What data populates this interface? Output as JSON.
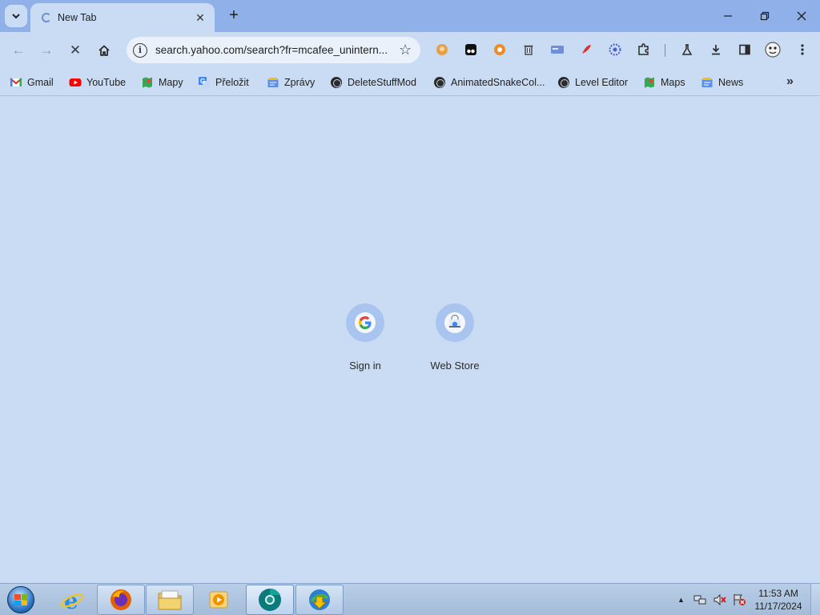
{
  "browser": {
    "tab": {
      "title": "New Tab"
    },
    "new_tab_symbol": "+",
    "window_controls": {
      "minimize": "—",
      "restore": "❐",
      "close": "✕"
    },
    "toolbar": {
      "back": "←",
      "forward": "→",
      "stop": "✕",
      "url": "search.yahoo.com/search?fr=mcafee_unintern..."
    },
    "bookmarks": [
      {
        "label": "Gmail",
        "icon": "gmail-icon"
      },
      {
        "label": "YouTube",
        "icon": "youtube-icon"
      },
      {
        "label": "Mapy",
        "icon": "maps-icon"
      },
      {
        "label": "Přeložit",
        "icon": "translate-icon"
      },
      {
        "label": "Zprávy",
        "icon": "news-icon"
      },
      {
        "label": "DeleteStuffMod",
        "icon": "globe-icon"
      },
      {
        "label": "AnimatedSnakeCol...",
        "icon": "globe-icon"
      },
      {
        "label": "Level Editor",
        "icon": "globe-icon"
      },
      {
        "label": "Maps",
        "icon": "maps-icon"
      },
      {
        "label": "News",
        "icon": "news-icon"
      }
    ],
    "bookmarks_overflow": "»"
  },
  "shortcuts": [
    {
      "label": "Sign in",
      "icon": "google-icon"
    },
    {
      "label": "Web Store",
      "icon": "web-store-icon"
    }
  ],
  "taskbar": {
    "apps": [
      "internet-explorer-icon",
      "firefox-icon",
      "file-explorer-icon",
      "media-player-icon",
      "chrome-canary-icon",
      "download-manager-icon"
    ],
    "tray_arrow": "▲",
    "clock": {
      "time": "11:53 AM",
      "date": "11/17/2024"
    }
  },
  "colors": {
    "background": "#c9dcf3",
    "tabstrip": "#8fb0e8",
    "shortcut_circle": "#a9c5ef"
  }
}
